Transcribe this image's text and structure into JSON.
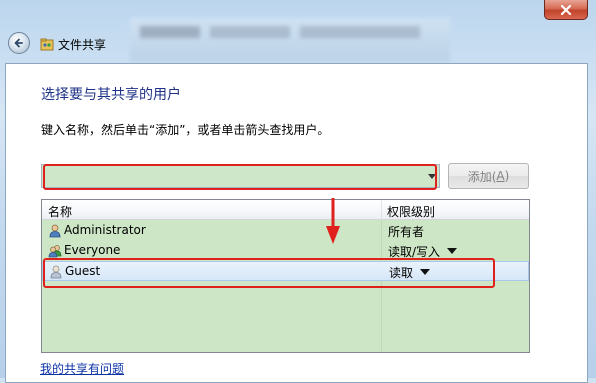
{
  "window": {
    "title": "文件共享",
    "close_icon": "close-icon",
    "back_icon": "back-arrow-icon"
  },
  "main": {
    "heading": "选择要与其共享的用户",
    "instruction": "键入名称，然后单击“添加”，或者单击箭头查找用户。",
    "name_input": {
      "value": "",
      "placeholder": ""
    },
    "add_button": {
      "label": "添加(",
      "accel": "A",
      "suffix": ")"
    },
    "list": {
      "columns": [
        "名称",
        "权限级别"
      ],
      "rows": [
        {
          "name": "Administrator",
          "permission": "所有者",
          "icon": "user-icon",
          "has_dropdown": false,
          "selected": false
        },
        {
          "name": "Everyone",
          "permission": "读取/写入",
          "icon": "group-icon",
          "has_dropdown": true,
          "selected": false
        },
        {
          "name": "Guest",
          "permission": "读取",
          "icon": "user-icon",
          "has_dropdown": true,
          "selected": true
        }
      ]
    },
    "help_link": "我的共享有问题"
  },
  "colors": {
    "heading": "#1e3287",
    "link": "#0c33a5",
    "annotation": "#e0201c",
    "highlight_fill": "#cde6c6"
  }
}
